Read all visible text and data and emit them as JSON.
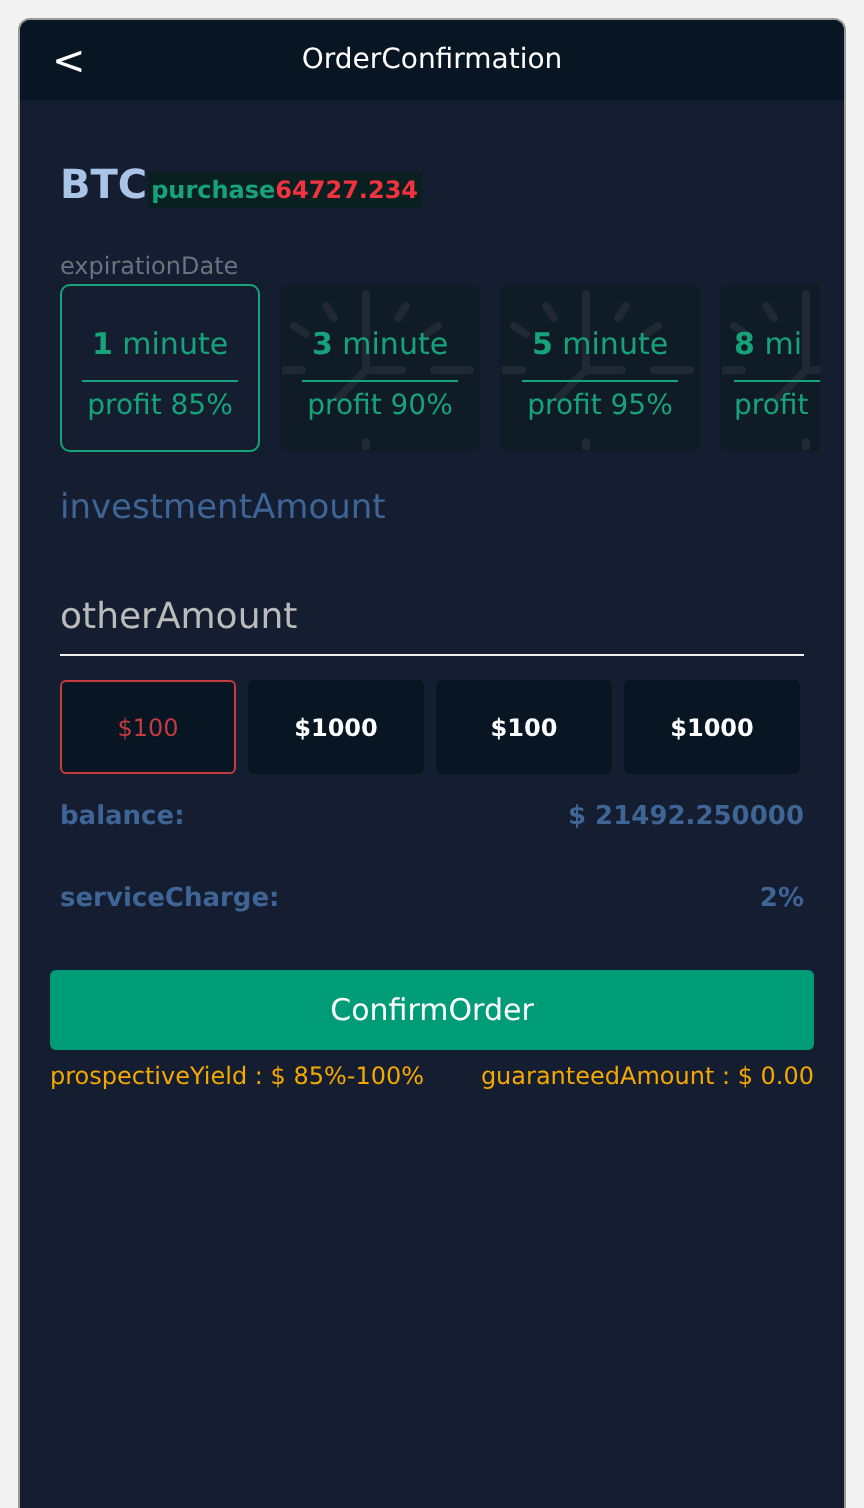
{
  "header": {
    "back": "<",
    "title": "OrderConfirmation"
  },
  "coin": {
    "symbol": "BTC",
    "action": "purchase",
    "price": "64727.234"
  },
  "expiration": {
    "label": "expirationDate",
    "options": [
      {
        "value": "1",
        "unit": "minute",
        "profit": "profit 85%",
        "selected": true
      },
      {
        "value": "3",
        "unit": "minute",
        "profit": "profit 90%",
        "selected": false
      },
      {
        "value": "5",
        "unit": "minute",
        "profit": "profit 95%",
        "selected": false
      },
      {
        "value": "8",
        "unit": "mi",
        "profit": "profit",
        "selected": false
      }
    ]
  },
  "investment": {
    "label": "investmentAmount",
    "placeholder": "otherAmount",
    "amounts": [
      {
        "label": "$100",
        "selected": true
      },
      {
        "label": "$1000",
        "selected": false
      },
      {
        "label": "$100",
        "selected": false
      },
      {
        "label": "$1000",
        "selected": false
      }
    ]
  },
  "summary": [
    {
      "label": "balance:",
      "value": "$ 21492.250000"
    },
    {
      "label": "serviceCharge:",
      "value": "2%"
    }
  ],
  "confirm": "ConfirmOrder",
  "footer": {
    "yield": "prospectiveYield : $ 85%-100%",
    "guaranteed": "guaranteedAmount : $ 0.00"
  }
}
